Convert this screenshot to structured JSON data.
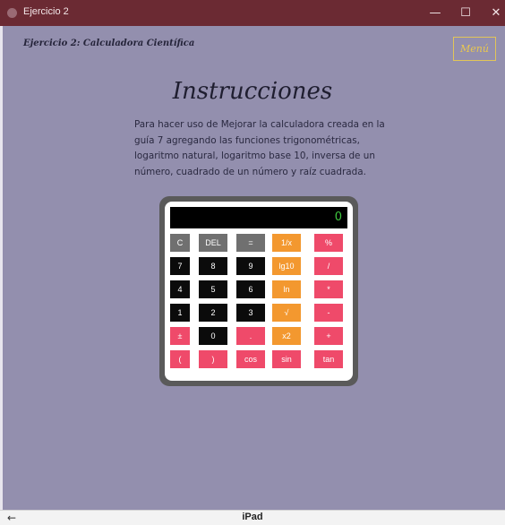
{
  "window": {
    "title": "Ejercicio 2",
    "controls": {
      "minimize": "—",
      "maximize": "☐",
      "close": "✕"
    }
  },
  "header": {
    "subtitle": "Ejercicio 2: Calculadora Científica",
    "menu_label": "Menú",
    "menu_color": "#e9c750"
  },
  "main": {
    "heading": "Instrucciones",
    "description_lines": [
      "Para hacer uso de Mejorar la calculadora creada en la",
      "guía 7 agregando las funciones trigonométricas,",
      "logaritmo natural, logaritmo base 10, inversa de un",
      "número, cuadrado de un número y raíz cuadrada."
    ],
    "background": "#938fae"
  },
  "calculator": {
    "display_value": "0",
    "colors": {
      "gray": "#707070",
      "black": "#0b0b0b",
      "orange": "#f3982f",
      "pink": "#ef4a6a",
      "display_text": "#3ec73e"
    },
    "rows": [
      [
        {
          "label": "C",
          "color": "gray"
        },
        {
          "label": "DEL",
          "color": "gray"
        },
        {
          "label": "=",
          "color": "gray"
        },
        {
          "label": "1/x",
          "color": "orange"
        },
        {
          "label": "%",
          "color": "pink"
        }
      ],
      [
        {
          "label": "7",
          "color": "black"
        },
        {
          "label": "8",
          "color": "black"
        },
        {
          "label": "9",
          "color": "black"
        },
        {
          "label": "lg10",
          "color": "orange"
        },
        {
          "label": "/",
          "color": "pink"
        }
      ],
      [
        {
          "label": "4",
          "color": "black"
        },
        {
          "label": "5",
          "color": "black"
        },
        {
          "label": "6",
          "color": "black"
        },
        {
          "label": "ln",
          "color": "orange"
        },
        {
          "label": "*",
          "color": "pink"
        }
      ],
      [
        {
          "label": "1",
          "color": "black"
        },
        {
          "label": "2",
          "color": "black"
        },
        {
          "label": "3",
          "color": "black"
        },
        {
          "label": "√",
          "color": "orange"
        },
        {
          "label": "-",
          "color": "pink"
        }
      ],
      [
        {
          "label": "±",
          "color": "pink"
        },
        {
          "label": "0",
          "color": "black"
        },
        {
          "label": ".",
          "color": "pink"
        },
        {
          "label": "x2",
          "color": "orange"
        },
        {
          "label": "+",
          "color": "pink"
        }
      ],
      [
        {
          "label": "(",
          "color": "pink"
        },
        {
          "label": ")",
          "color": "pink"
        },
        {
          "label": "cos",
          "color": "pink"
        },
        {
          "label": "sin",
          "color": "pink"
        },
        {
          "label": "tan",
          "color": "pink"
        }
      ]
    ]
  },
  "footer": {
    "back_icon": "←",
    "device_label": "iPad"
  }
}
